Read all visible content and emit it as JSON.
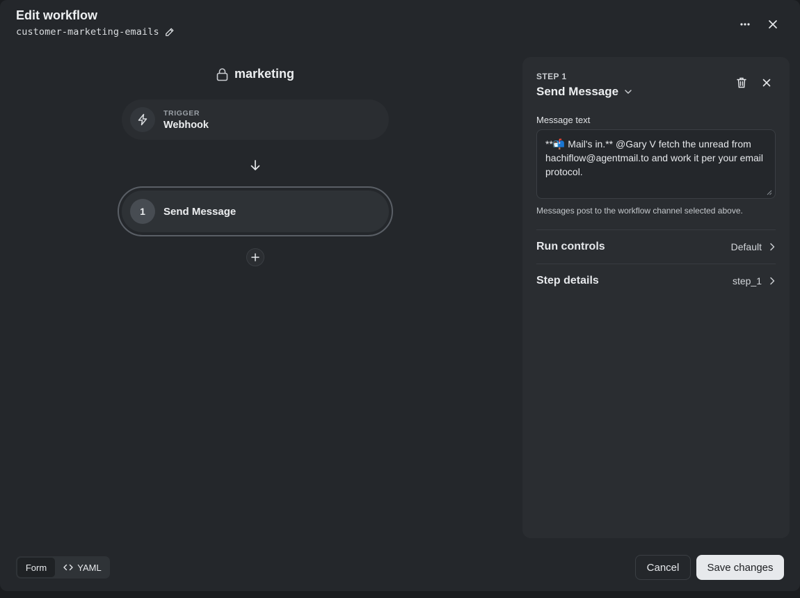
{
  "header": {
    "title": "Edit workflow",
    "slug": "customer-marketing-emails"
  },
  "canvas": {
    "channel_name": "marketing",
    "trigger": {
      "kicker": "TRIGGER",
      "label": "Webhook"
    },
    "steps": [
      {
        "number": "1",
        "label": "Send Message"
      }
    ]
  },
  "panel": {
    "kicker": "STEP 1",
    "title": "Send Message",
    "message_label": "Message text",
    "message_text": "**📬 Mail's in.** @Gary V fetch the unread from hachiflow@agentmail.to and work it per your email protocol.",
    "helper": "Messages post to the workflow channel selected above.",
    "rows": [
      {
        "label": "Run controls",
        "value": "Default"
      },
      {
        "label": "Step details",
        "value": "step_1"
      }
    ]
  },
  "footer": {
    "view_toggle": {
      "form": "Form",
      "yaml": "YAML",
      "selected": "Form"
    },
    "cancel": "Cancel",
    "save": "Save changes"
  },
  "icons": {
    "edit": "pencil-icon",
    "more": "more-horizontal-icon",
    "close": "close-icon",
    "lock": "lock-icon",
    "trigger": "lightning-bolt-icon",
    "arrow": "arrow-down-icon",
    "add": "plus-icon",
    "delete": "trash-icon",
    "dropdown": "chevron-down-icon",
    "row": "chevron-right-icon",
    "code": "code-icon"
  }
}
